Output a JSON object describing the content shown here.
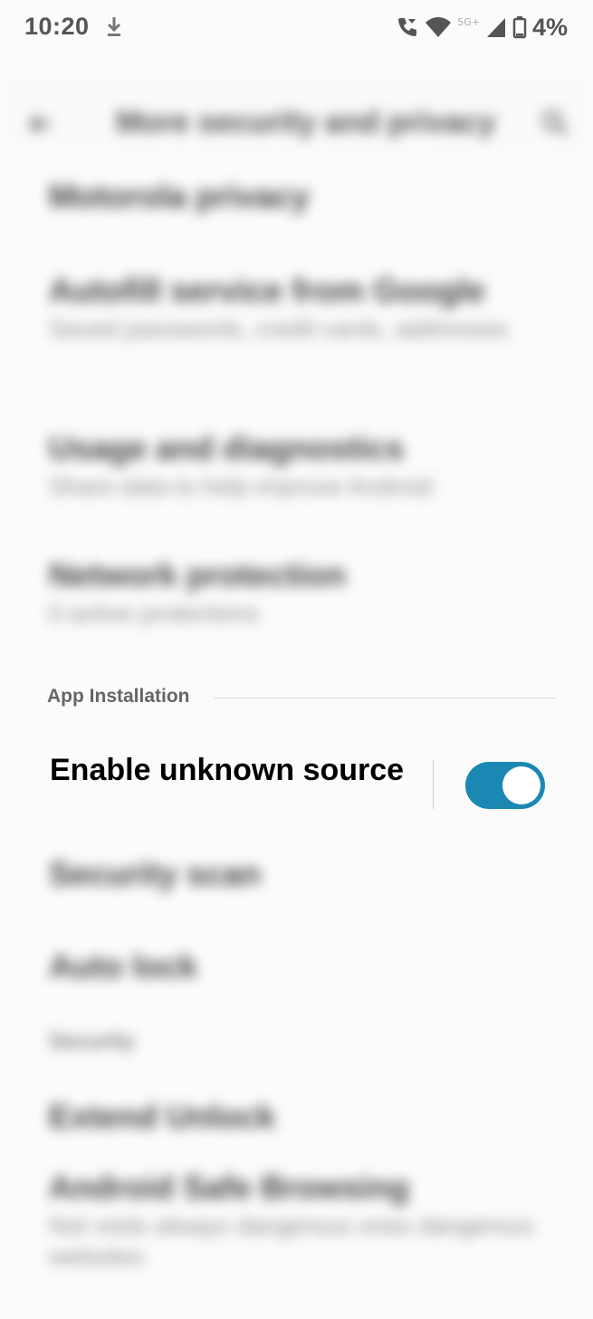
{
  "status_bar": {
    "time": "10:20",
    "network": "5G+",
    "battery": "4%"
  },
  "header": {
    "title": "More security and privacy"
  },
  "blurred_items": [
    {
      "title": "Motorola privacy",
      "summary": ""
    },
    {
      "title": "Autofill service from Google",
      "summary": "Saved passwords, credit cards, addresses"
    },
    {
      "title": "Usage and diagnostics",
      "summary": "Share data to help improve Android"
    },
    {
      "title": "Network protection",
      "summary": "0 active protections"
    }
  ],
  "app_installation": {
    "category": "App Installation",
    "enable_unknown_source": {
      "label": "Enable unknown source",
      "checked": true,
      "accent": "#1b88b4"
    }
  },
  "blurred_items_lower": [
    {
      "title": "Security scan",
      "summary": ""
    },
    {
      "title": "Auto lock",
      "summary": ""
    }
  ],
  "blurred_category": "Security",
  "blurred_items_bottom": [
    {
      "title": "Extend Unlock",
      "summary": ""
    },
    {
      "title": "Android Safe Browsing",
      "summary": "Not visits always dangerous ones dangerous websites"
    }
  ],
  "icons": {
    "download": "download-icon",
    "call": "wifi-call-icon",
    "wifi": "wifi-icon",
    "signal": "signal-icon",
    "battery": "battery-icon",
    "back": "back-arrow-icon",
    "search": "search-icon"
  }
}
